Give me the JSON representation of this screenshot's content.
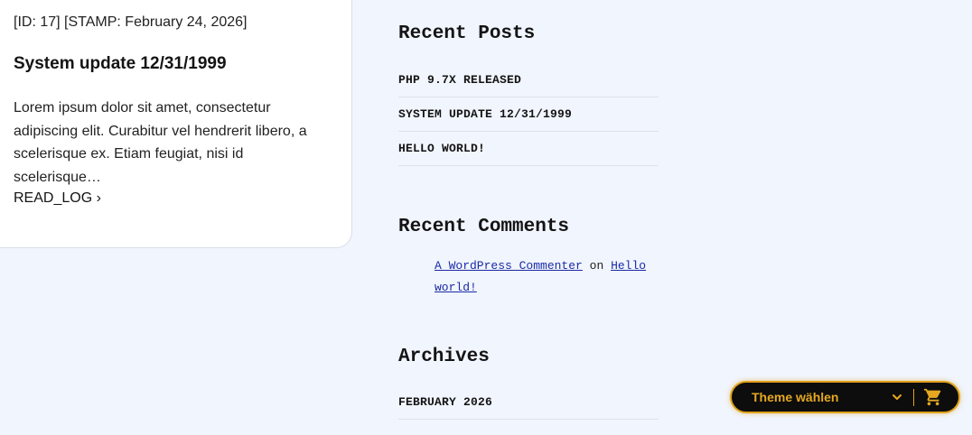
{
  "post": {
    "meta": "[ID: 17] [STAMP: February 24, 2026]",
    "title": "System update 12/31/1999",
    "excerpt": "Lorem ipsum dolor sit amet, consectetur adipiscing elit. Curabitur vel hendrerit libero, a scelerisque ex. Etiam feugiat, nisi id scelerisque…",
    "read_more": "READ_LOG ›"
  },
  "sidebar": {
    "recent_posts": {
      "title": "Recent Posts",
      "items": [
        "PHP 9.7X RELEASED",
        "SYSTEM UPDATE 12/31/1999",
        "HELLO WORLD!"
      ]
    },
    "recent_comments": {
      "title": "Recent Comments",
      "author": "A WordPress Commenter",
      "connector": "on",
      "post_link": "Hello world!"
    },
    "archives": {
      "title": "Archives",
      "items": [
        "FEBRUARY 2026"
      ]
    }
  },
  "theme_bar": {
    "label": "Theme wählen",
    "chevron_icon": "chevron-down-icon",
    "cart_icon": "shopping-cart-icon",
    "accent_color": "#e0a21a",
    "background_color": "#0d0d0d"
  },
  "colors": {
    "page_background": "#f1f5fd",
    "card_background": "#ffffff",
    "link_color": "#1a2aa8"
  }
}
